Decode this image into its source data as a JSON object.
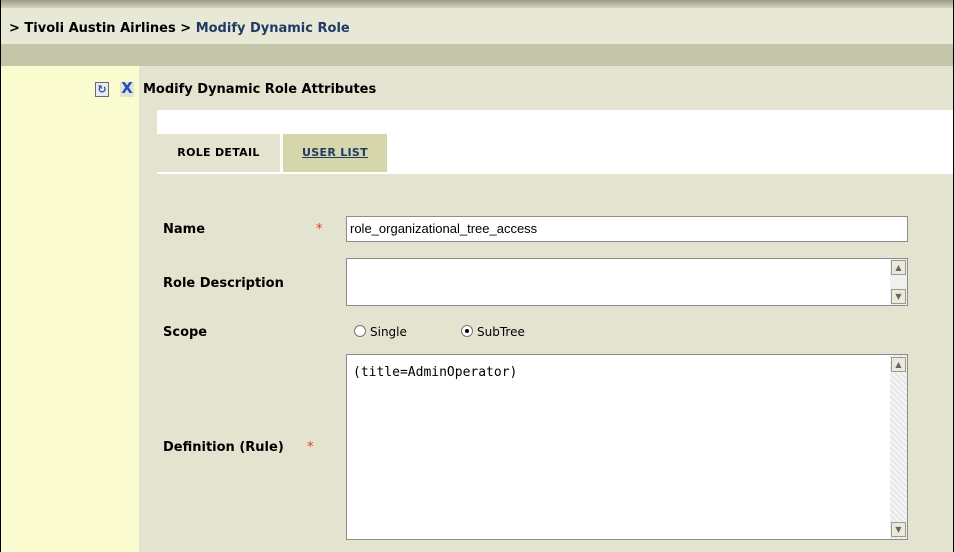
{
  "breadcrumb": {
    "prefix": "> Tivoli Austin Airlines > ",
    "current": "Modify Dynamic Role"
  },
  "header": {
    "title": "Modify Dynamic Role Attributes",
    "refresh_icon": "refresh-icon",
    "close_icon": "close-icon",
    "close_glyph": "X",
    "refresh_glyph": "↻"
  },
  "tabs": [
    {
      "label": "Role Detail",
      "display": "ROLE DETAIL",
      "active": true
    },
    {
      "label": "User List",
      "display": "USER LIST",
      "active": false
    }
  ],
  "form": {
    "name_label": "Name",
    "name_value": "role_organizational_tree_access",
    "required_marker": "*",
    "description_label": "Role Description",
    "description_value": "",
    "scope_label": "Scope",
    "scope_options": [
      "Single",
      "SubTree"
    ],
    "scope_selected": "SubTree",
    "definition_label": "Definition (Rule)",
    "definition_value": "(title=AdminOperator)"
  },
  "colors": {
    "breadcrumb_link": "#1f3a66",
    "required": "#e23a1f",
    "sidebar": "#fbfbd0",
    "panel": "#e3e3cf"
  }
}
